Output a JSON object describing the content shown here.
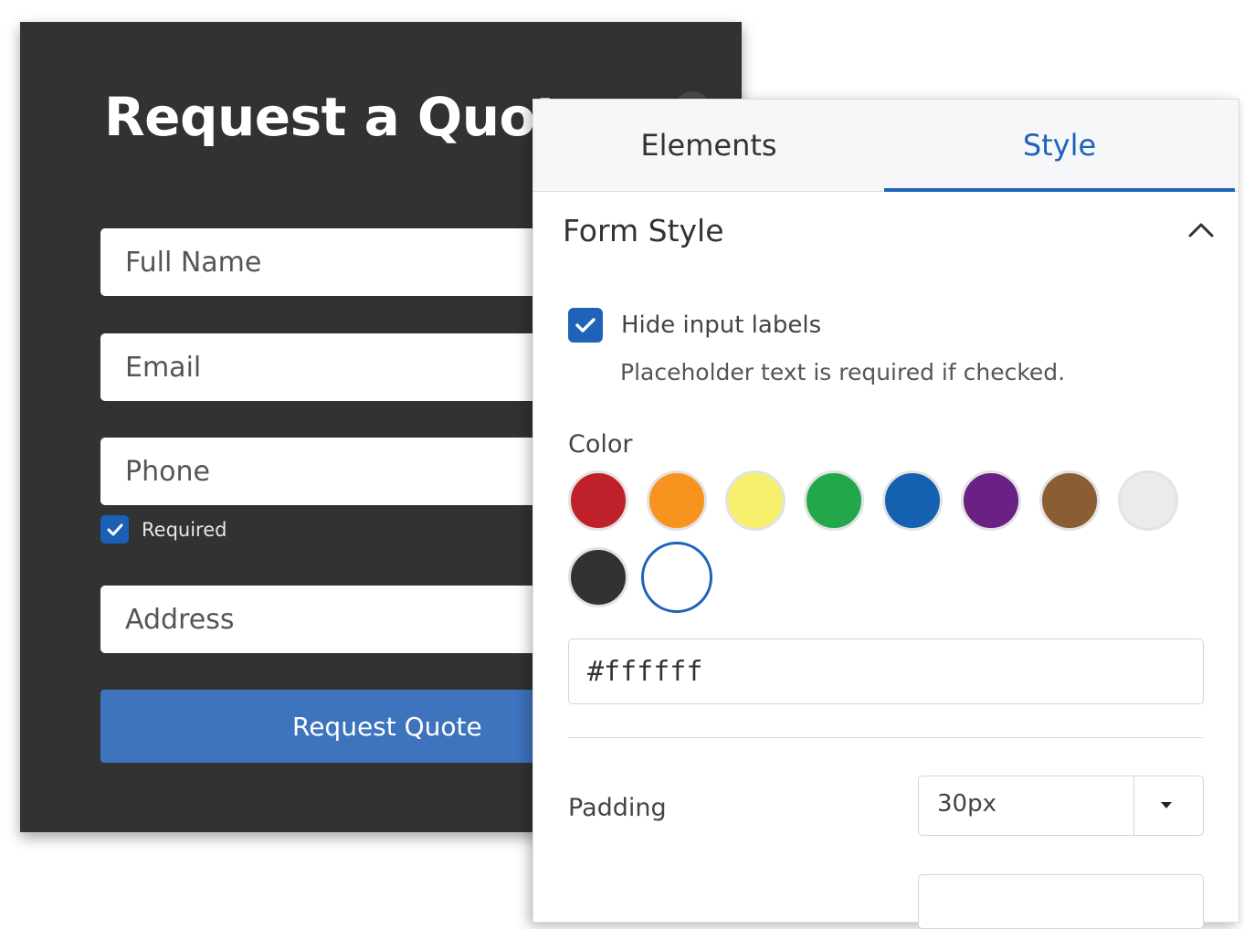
{
  "quote_form": {
    "title": "Request a Quote",
    "fields": [
      {
        "placeholder": "Full Name"
      },
      {
        "placeholder": "Email"
      },
      {
        "placeholder": "Phone"
      },
      {
        "placeholder": "Address"
      }
    ],
    "required_label": "Required",
    "submit_label": "Request Quote"
  },
  "panel": {
    "tabs": [
      {
        "label": "Elements",
        "active": false
      },
      {
        "label": "Style",
        "active": true
      }
    ],
    "section_title": "Form Style",
    "hide_labels": {
      "label": "Hide input labels",
      "checked": true,
      "hint": "Placeholder text is required if checked."
    },
    "color": {
      "label": "Color",
      "swatches": [
        "#c0202a",
        "#f7931e",
        "#f7f06d",
        "#22a84a",
        "#1560b0",
        "#6b2183",
        "#8b5d33",
        "#ebebeb",
        "#323232",
        "#ffffff"
      ],
      "selected": "#ffffff",
      "hex_value": "#ffffff"
    },
    "padding": {
      "label": "Padding",
      "value": "30px"
    }
  },
  "colors": {
    "accent": "#1f63b8",
    "button": "#3e73bd",
    "card_background": "#323232"
  }
}
